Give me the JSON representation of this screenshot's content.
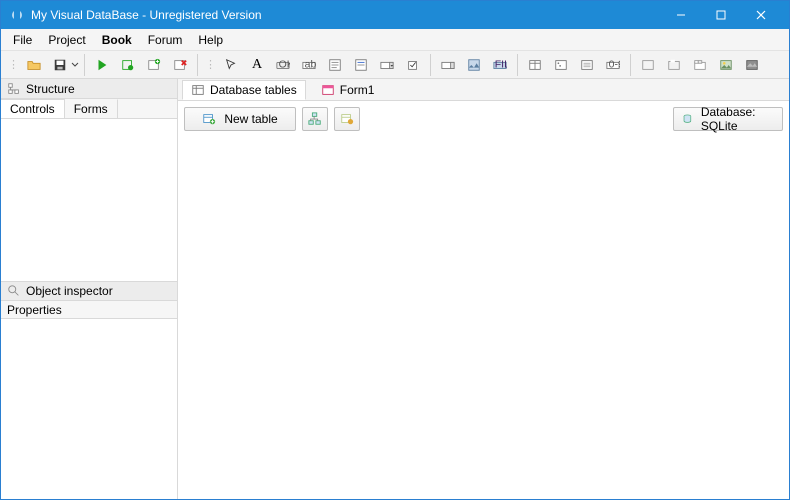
{
  "window": {
    "title": "My Visual DataBase - Unregistered Version"
  },
  "menu": {
    "file": "File",
    "project": "Project",
    "book": "Book",
    "forum": "Forum",
    "help": "Help"
  },
  "left": {
    "structure": "Structure",
    "tabs": {
      "controls": "Controls",
      "forms": "Forms"
    },
    "inspector": "Object inspector",
    "properties": "Properties"
  },
  "right": {
    "tabs": {
      "db": "Database tables",
      "form1": "Form1"
    },
    "newtable": "New table",
    "database_btn": "Database: SQLite"
  }
}
